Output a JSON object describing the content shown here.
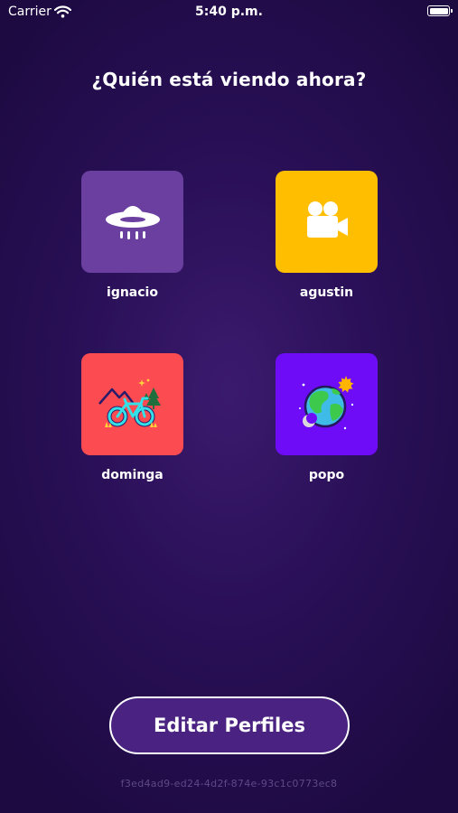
{
  "status_bar": {
    "carrier": "Carrier",
    "time": "5:40 p.m."
  },
  "title": "¿Quién está viendo ahora?",
  "profiles": [
    {
      "name": "ignacio",
      "icon": "ufo-icon",
      "color": "#6a3fa0"
    },
    {
      "name": "agustin",
      "icon": "movie-camera-icon",
      "color": "#ffbf00"
    },
    {
      "name": "dominga",
      "icon": "bicycle-mountains-icon",
      "color": "#fc4c52"
    },
    {
      "name": "popo",
      "icon": "planet-earth-icon",
      "color": "#6f0cf7"
    }
  ],
  "edit_button_label": "Editar Perfiles",
  "device_id": "f3ed4ad9-ed24-4d2f-874e-93c1c0773ec8"
}
